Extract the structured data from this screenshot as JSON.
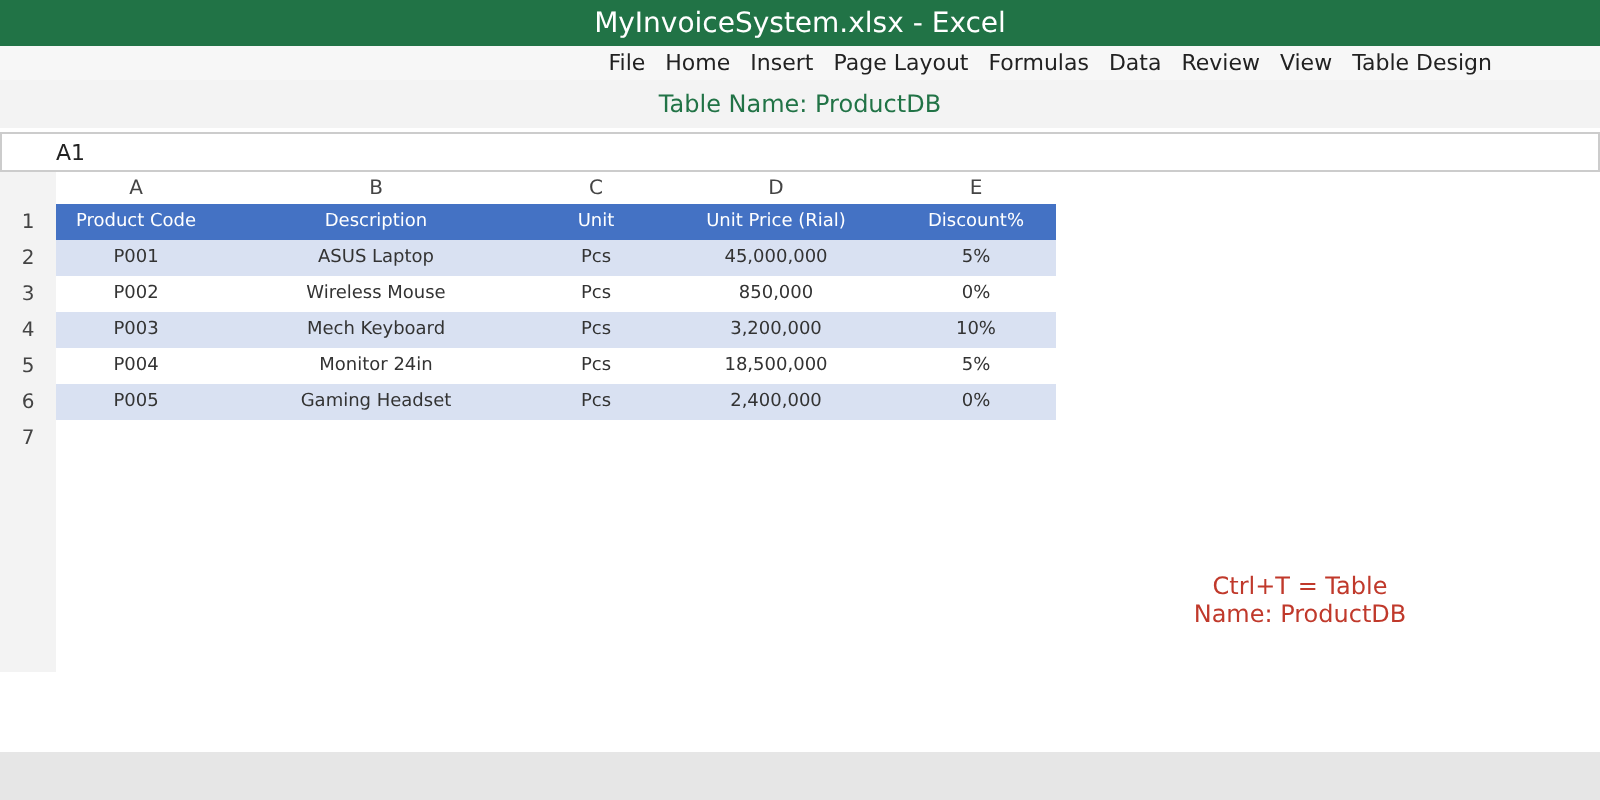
{
  "window": {
    "title": "MyInvoiceSystem.xlsx - Excel"
  },
  "menu": [
    "File",
    "Home",
    "Insert",
    "Page Layout",
    "Formulas",
    "Data",
    "Review",
    "View",
    "Table Design"
  ],
  "banner": "Table Name: ProductDB",
  "name_box": {
    "value": "A1"
  },
  "sheet": {
    "column_letters": [
      "A",
      "B",
      "C",
      "D",
      "E"
    ],
    "row_numbers": [
      "1",
      "2",
      "3",
      "4",
      "5",
      "6",
      "7"
    ],
    "table": {
      "columns": [
        "Product Code",
        "Description",
        "Unit",
        "Unit Price (Rial)",
        "Discount%"
      ],
      "rows": [
        [
          "P001",
          "ASUS Laptop",
          "Pcs",
          "45,000,000",
          "5%"
        ],
        [
          "P002",
          "Wireless Mouse",
          "Pcs",
          "850,000",
          "0%"
        ],
        [
          "P003",
          "Mech Keyboard",
          "Pcs",
          "3,200,000",
          "10%"
        ],
        [
          "P004",
          "Monitor 24in",
          "Pcs",
          "18,500,000",
          "5%"
        ],
        [
          "P005",
          "Gaming Headset",
          "Pcs",
          "2,400,000",
          "0%"
        ]
      ]
    }
  },
  "note": [
    "Ctrl+T = Table",
    "Name: ProductDB"
  ]
}
